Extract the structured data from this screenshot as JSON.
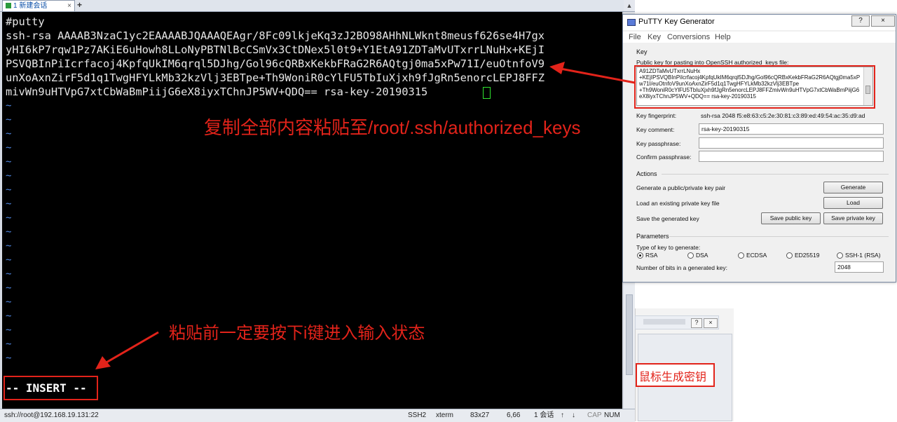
{
  "terminal": {
    "tab_label": "1 新建会话",
    "tab_close": "×",
    "tab_add": "+",
    "scroll_up": "▲",
    "lines": [
      "#putty",
      "ssh-rsa AAAAB3NzaC1yc2EAAAABJQAAAQEAgr/8Fc09lkjeKq3zJ2BO98AHhNLWknt8meusf626se4H7gx",
      "yHI6kP7rqw1Pz7AKiE6uHowh8LLoNyPBTNlBcCSmVx3CtDNex5l0t9+Y1EtA91ZDTaMvUTxrrLNuHx+KEjI",
      "PSVQBInPiIcrfacoj4KpfqUkIM6qrql5DJhg/Gol96cQRBxKekbFRaG2R6AQtgj0ma5xPw71I/euOtnfoV9",
      "unXoAxnZirF5d1q1TwgHFYLkMb32kzVlj3EBTpe+Th9WoniR0cYlFU5TbIuXjxh9fJgRn5enorcLEPJ8FFZ",
      "mivWn9uHTVpG7xtCbWaBmPiijG6eX8iyxTChnJP5WV+QDQ== rsa-key-20190315"
    ],
    "tilde": "~",
    "insert_mode": "-- INSERT --"
  },
  "status_bar": {
    "connection": "ssh://root@192.168.19.131:22",
    "protocol": "SSH2",
    "terminal_type": "xterm",
    "size": "83x27",
    "cursor_pos": "6,66",
    "sessions": "1 会话",
    "up_arrow": "↑",
    "down_arrow": "↓",
    "caps": "CAP",
    "num": "NUM"
  },
  "annotations": {
    "copy_instruction": "复制全部内容粘贴至/root/.ssh/authorized_keys",
    "insert_instruction": "粘贴前一定要按下i键进入输入状态",
    "generate_tip": "鼠标生成密钥"
  },
  "background_window": {
    "help": "?",
    "close": "×"
  },
  "puttygen": {
    "title": "PuTTY Key Generator",
    "help_button": "?",
    "close_button": "×",
    "menu": [
      "File",
      "Key",
      "Conversions",
      "Help"
    ],
    "key_group": "Key",
    "public_key_label": "Public key for pasting into OpenSSH authorized_keys file:",
    "public_key_text": "A91ZDTaMvUTxrrLNuHx\n+KEjIPSVQBInPiIcrfacoj4KpfqUkIM6qrql5DJhg/Gol96cQRBxKekbFRaG2R6AQtgj0ma5xPw71I/euOtnfoV9unXoAxnZirF5d1q1TwgHFYLkMb32kzVlj3EBTpe\n+Th9WoniR0cYlFU5TbIuXjxh9fJgRn5enorcLEPJ8FFZmivWn9uHTVpG7xtCbWaBmPiijG6eX8iyxTChnJP5WV+QDQ== rsa-key-20190315",
    "fingerprint_label": "Key fingerprint:",
    "fingerprint_value": "ssh-rsa 2048 f5:e8:63:c5:2e:30:81:c3:89:ed:49:54:ac:35:d9:ad",
    "comment_label": "Key comment:",
    "comment_value": "rsa-key-20190315",
    "passphrase_label": "Key passphrase:",
    "passphrase_value": "",
    "confirm_label": "Confirm passphrase:",
    "confirm_value": "",
    "actions_group": "Actions",
    "generate_label": "Generate a public/private key pair",
    "generate_button": "Generate",
    "load_label": "Load an existing private key file",
    "load_button": "Load",
    "save_label": "Save the generated key",
    "save_public_button": "Save public key",
    "save_private_button": "Save private key",
    "parameters_group": "Parameters",
    "key_type_label": "Type of key to generate:",
    "key_types": [
      "RSA",
      "DSA",
      "ECDSA",
      "ED25519",
      "SSH-1 (RSA)"
    ],
    "selected_key_type": "RSA",
    "bits_label": "Number of bits in a generated key:",
    "bits_value": "2048"
  },
  "colors": {
    "annotation_red": "#e2231a",
    "terminal_bg": "#000000",
    "tilde_blue": "#4f86e0",
    "cursor_green": "#2fe32f"
  }
}
